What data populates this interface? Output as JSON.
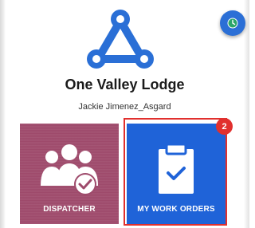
{
  "organization": {
    "name": "One Valley Lodge",
    "logo_icon": "tri-node-logo-icon",
    "logo_color": "#2a6fd6"
  },
  "user": {
    "name": "Jackie Jimenez_Asgard"
  },
  "header": {
    "history_icon": "clock-icon",
    "history_button_color": "#2b6fd6"
  },
  "tiles": [
    {
      "label": "DISPATCHER",
      "icon": "group-check-icon",
      "color": "#9e4a6b"
    },
    {
      "label": "MY WORK ORDERS",
      "icon": "clipboard-check-icon",
      "color": "#1f63d8",
      "badge_count": "2",
      "badge_color": "#e1302e",
      "highlighted": true
    }
  ]
}
